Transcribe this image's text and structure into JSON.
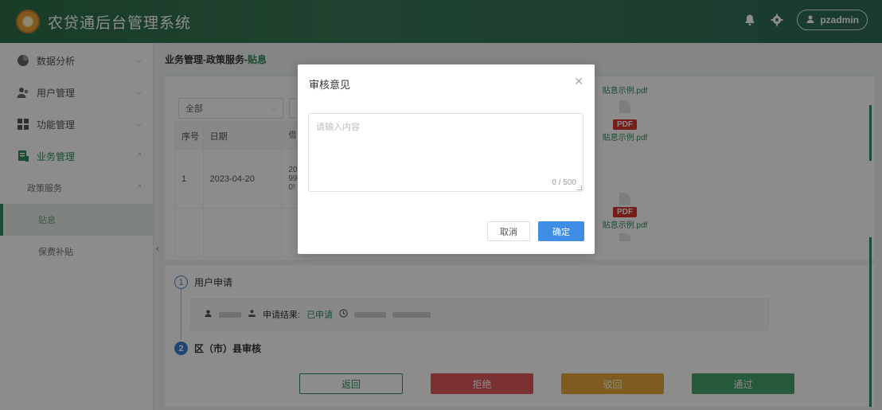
{
  "header": {
    "title": "农贷通后台管理系统",
    "username": "pzadmin",
    "icons": [
      "bell-icon",
      "gear-icon",
      "user-icon"
    ]
  },
  "sidebar": {
    "items": [
      {
        "label": "数据分析",
        "icon": "pie-chart-icon"
      },
      {
        "label": "用户管理",
        "icon": "users-icon"
      },
      {
        "label": "功能管理",
        "icon": "grid-icon"
      },
      {
        "label": "业务管理",
        "icon": "business-icon"
      }
    ],
    "submenu": {
      "label": "政策服务"
    },
    "leaves": [
      {
        "label": "贴息"
      },
      {
        "label": "保费补贴"
      }
    ]
  },
  "breadcrumb": {
    "path": "业务管理-政策服务-",
    "current": "贴息"
  },
  "filter": {
    "selected": "全部"
  },
  "table": {
    "headers": [
      "序号",
      "日期"
    ],
    "rows": [
      {
        "no": "1",
        "date": "2023-04-20",
        "partial": "20\n99\n0!"
      }
    ]
  },
  "files": [
    {
      "name": "贴息示例.pdf",
      "badge": ""
    },
    {
      "name": "贴息示例.pdf",
      "badge": "PDF"
    },
    {
      "name": "贴息示例.pdf",
      "badge": "PDF"
    }
  ],
  "steps": [
    {
      "num": "1",
      "label": "用户申请"
    },
    {
      "num": "2",
      "label": "区（市）县审核"
    }
  ],
  "step_detail": {
    "result_label": "申请结果:",
    "result_value": "已申请"
  },
  "actions": {
    "back": "返回",
    "reject": "拒绝",
    "return": "驳回",
    "pass": "通过"
  },
  "modal": {
    "title": "审核意见",
    "placeholder": "请输入内容",
    "count": "0 / 500",
    "cancel": "取消",
    "confirm": "确定"
  },
  "colors": {
    "brand": "#2f8f5b",
    "primary": "#3e8ee6",
    "danger": "#e15a5a",
    "warning": "#e5a83b",
    "success": "#46a46b"
  }
}
